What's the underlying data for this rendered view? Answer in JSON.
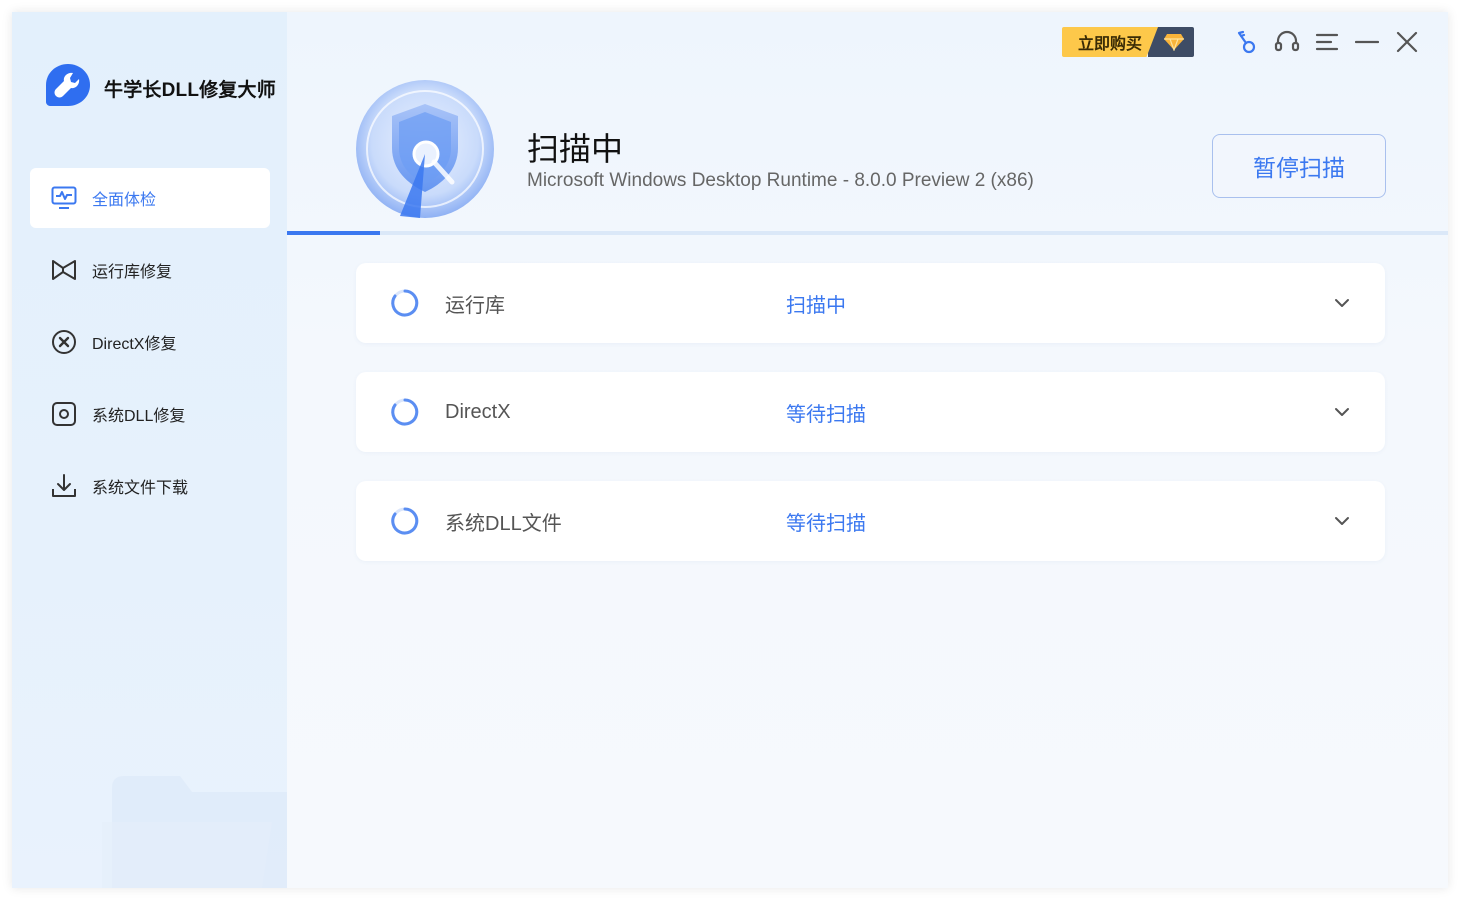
{
  "app": {
    "title": "牛学长DLL修复大师"
  },
  "sidebar": {
    "items": [
      {
        "label": "全面体检",
        "icon": "monitor-pulse-icon",
        "active": true
      },
      {
        "label": "运行库修复",
        "icon": "bowtie-runtime-icon",
        "active": false
      },
      {
        "label": "DirectX修复",
        "icon": "x-circle-icon",
        "active": false
      },
      {
        "label": "系统DLL修复",
        "icon": "gear-square-icon",
        "active": false
      },
      {
        "label": "系统文件下载",
        "icon": "download-icon",
        "active": false
      }
    ]
  },
  "topbar": {
    "buy_label": "立即购买",
    "icons": [
      "key-icon",
      "headset-icon",
      "menu-icon",
      "minimize-icon",
      "close-icon"
    ]
  },
  "scan": {
    "title": "扫描中",
    "current_item": "Microsoft Windows Desktop Runtime - 8.0.0 Preview 2 (x86)",
    "pause_label": "暂停扫描",
    "progress_percent": 8
  },
  "rows": [
    {
      "name": "运行库",
      "status": "扫描中"
    },
    {
      "name": "DirectX",
      "status": "等待扫描"
    },
    {
      "name": "系统DLL文件",
      "status": "等待扫描"
    }
  ],
  "colors": {
    "accent": "#3b78f0",
    "buy": "#fdc84a",
    "buy_dark": "#3e4c65"
  }
}
